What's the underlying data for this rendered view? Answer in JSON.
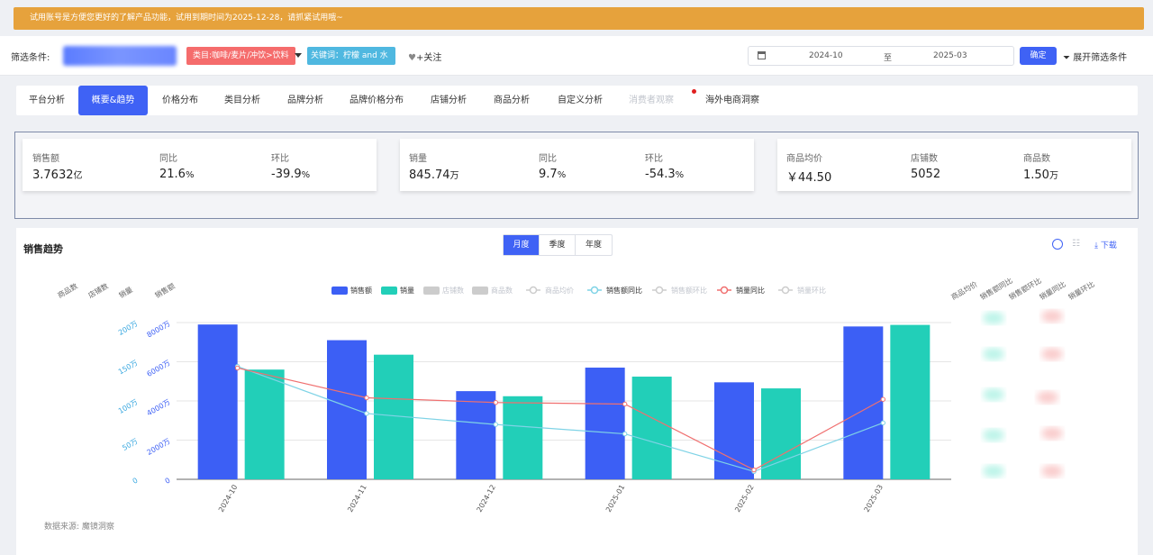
{
  "banner": {
    "text": "试用账号是方便您更好的了解产品功能，试用到期时间为2025-12-28，请抓紧试用哦~"
  },
  "filter": {
    "label": "筛选条件:",
    "category_tag": "类目:咖啡/麦片/冲饮>饮料",
    "keyword_tag": "关键词：柠檬 and 水",
    "follow": "+关注",
    "date_from": "2024-10",
    "date_sep": "至",
    "date_to": "2025-03",
    "confirm": "确定",
    "expand": "展开筛选条件"
  },
  "tabs": [
    {
      "label": "平台分析",
      "state": "normal"
    },
    {
      "label": "概要&趋势",
      "state": "active"
    },
    {
      "label": "价格分布",
      "state": "normal"
    },
    {
      "label": "类目分析",
      "state": "normal"
    },
    {
      "label": "品牌分析",
      "state": "normal"
    },
    {
      "label": "品牌价格分布",
      "state": "normal"
    },
    {
      "label": "店铺分析",
      "state": "normal"
    },
    {
      "label": "商品分析",
      "state": "normal"
    },
    {
      "label": "自定义分析",
      "state": "normal"
    },
    {
      "label": "消费者观察",
      "state": "disabled"
    },
    {
      "label": "海外电商洞察",
      "state": "normal"
    }
  ],
  "kpi": {
    "card1": {
      "sales_label": "销售额",
      "sales_value": "3.7632",
      "sales_unit": "亿",
      "yoy_label": "同比",
      "yoy_value": "21.6",
      "yoy_unit": "%",
      "mom_label": "环比",
      "mom_value": "-39.9",
      "mom_unit": "%"
    },
    "card2": {
      "vol_label": "销量",
      "vol_value": "845.74",
      "vol_unit": "万",
      "yoy_label": "同比",
      "yoy_value": "9.7",
      "yoy_unit": "%",
      "mom_label": "环比",
      "mom_value": "-54.3",
      "mom_unit": "%"
    },
    "card3": {
      "price_label": "商品均价",
      "price_value": "￥44.50",
      "shops_label": "店铺数",
      "shops_value": "5052",
      "items_label": "商品数",
      "items_value": "1.50",
      "items_unit": "万"
    }
  },
  "chart_panel": {
    "title": "销售趋势",
    "segments": [
      "月度",
      "季度",
      "年度"
    ],
    "active_segment": "月度",
    "download": "下载",
    "source": "数据来源: 魔镜洞察"
  },
  "colors": {
    "accent": "#3f62f5",
    "sales": "#3c5ff5",
    "volume": "#22cfb8",
    "sales_yoy": "#7fd3e6",
    "volume_yoy": "#f07070"
  },
  "chart_data": {
    "type": "bar",
    "categories": [
      "2024-10",
      "2024-11",
      "2024-12",
      "2025-01",
      "2025-02",
      "2025-03"
    ],
    "legend": [
      "销售额",
      "销量",
      "店铺数",
      "商品数",
      "商品均价",
      "销售额同比",
      "销售额环比",
      "销量同比",
      "销量环比"
    ],
    "legend_disabled": [
      "店铺数",
      "商品数",
      "商品均价",
      "销售额环比",
      "销量环比"
    ],
    "left_axis_titles": [
      "商品数",
      "店铺数",
      "销量",
      "销售额"
    ],
    "right_axis_titles": [
      "商品均价",
      "销售额同比",
      "销售额环比",
      "销量同比",
      "销量环比"
    ],
    "sales_axis": {
      "ticks": [
        "0",
        "2000万",
        "4000万",
        "6000万",
        "8000万"
      ],
      "max": 8000
    },
    "volume_axis": {
      "ticks": [
        "0",
        "50万",
        "100万",
        "150万",
        "200万"
      ],
      "max": 200
    },
    "series": [
      {
        "name": "销售额",
        "kind": "bar",
        "axis": "sales",
        "values": [
          7900,
          7100,
          4500,
          5700,
          4950,
          7800
        ]
      },
      {
        "name": "销量",
        "kind": "bar",
        "axis": "volume",
        "values": [
          140,
          159,
          106,
          131,
          116,
          197
        ]
      },
      {
        "name": "销售额同比",
        "kind": "line",
        "values": [
          0.72,
          0.42,
          0.35,
          0.29,
          0.05,
          0.36
        ]
      },
      {
        "name": "销量同比",
        "kind": "line",
        "values": [
          0.71,
          0.52,
          0.49,
          0.48,
          0.06,
          0.51
        ]
      }
    ]
  }
}
